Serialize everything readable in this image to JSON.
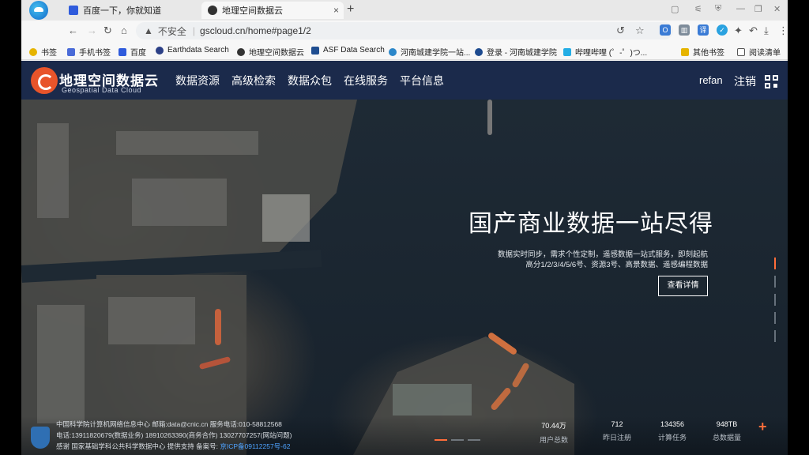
{
  "browser": {
    "tabs": [
      {
        "title": "百度一下，你就知道",
        "favicon_color": "#2f5bdc"
      },
      {
        "title": "地理空间数据云",
        "favicon_color": "#333333"
      }
    ],
    "new_tab": "+",
    "close_glyph": "×",
    "insecure_label": "不安全",
    "url": "gscloud.cn/home#page1/2"
  },
  "bookmarks": [
    {
      "label": "书签",
      "icon_color": "#e6b400"
    },
    {
      "label": "手机书签",
      "icon_color": "#4a6bd8"
    },
    {
      "label": "百度",
      "icon_color": "#2f5bdc"
    },
    {
      "label": "Earthdata Search",
      "icon_color": "#2b3f86"
    },
    {
      "label": "地理空间数据云",
      "icon_color": "#333333"
    },
    {
      "label": "ASF Data Search",
      "icon_color": "#1f4e91"
    },
    {
      "label": "河南城建学院一站...",
      "icon_color": "#2c87c9"
    },
    {
      "label": "登录 - 河南城建学院",
      "icon_color": "#1c4a8f"
    },
    {
      "label": "哔哩哔哩 (゜-゜)つ...",
      "icon_color": "#23ade5"
    },
    {
      "label": "其他书签",
      "icon_color": "#e6b400"
    },
    {
      "label": "阅读清单",
      "icon_color": "#555555"
    }
  ],
  "site": {
    "brand": "地理空间数据云",
    "brand_sub": "Geospatial Data Cloud",
    "nav": [
      "数据资源",
      "高级检索",
      "数据众包",
      "在线服务",
      "平台信息"
    ],
    "user": "refan",
    "logout": "注销"
  },
  "hero": {
    "title": "国产商业数据一站尽得",
    "sub1": "数据实时同步，需求个性定制，遥感数据一站式服务，即刻起航",
    "sub2": "高分1/2/3/4/5/6号、资源3号、高景数据、遥感编程数据",
    "button": "查看详情"
  },
  "footer": {
    "line1": "中国科学院计算机网络信息中心 邮箱:data@cnic.cn 服务电话:010-58812568",
    "line2": "电话:13911820679(数据业务) 18910263390(商务合作) 13027707257(网站问题)",
    "line3": "感谢 国家基础学科公共科学数据中心 提供支持 备案号:",
    "icp": "京ICP备09112257号-62",
    "stats": [
      {
        "value": "70.44万",
        "label": "用户总数"
      },
      {
        "value": "712",
        "label": "昨日注册"
      },
      {
        "value": "134356",
        "label": "计算任务"
      },
      {
        "value": "948TB",
        "label": "总数据量"
      }
    ]
  },
  "carousel": {
    "total": 3,
    "active": 1
  },
  "slide_dots": {
    "total": 5,
    "active": 1
  },
  "colors": {
    "header_bg": "#1b2a4b",
    "accent": "#ff6d3a"
  }
}
